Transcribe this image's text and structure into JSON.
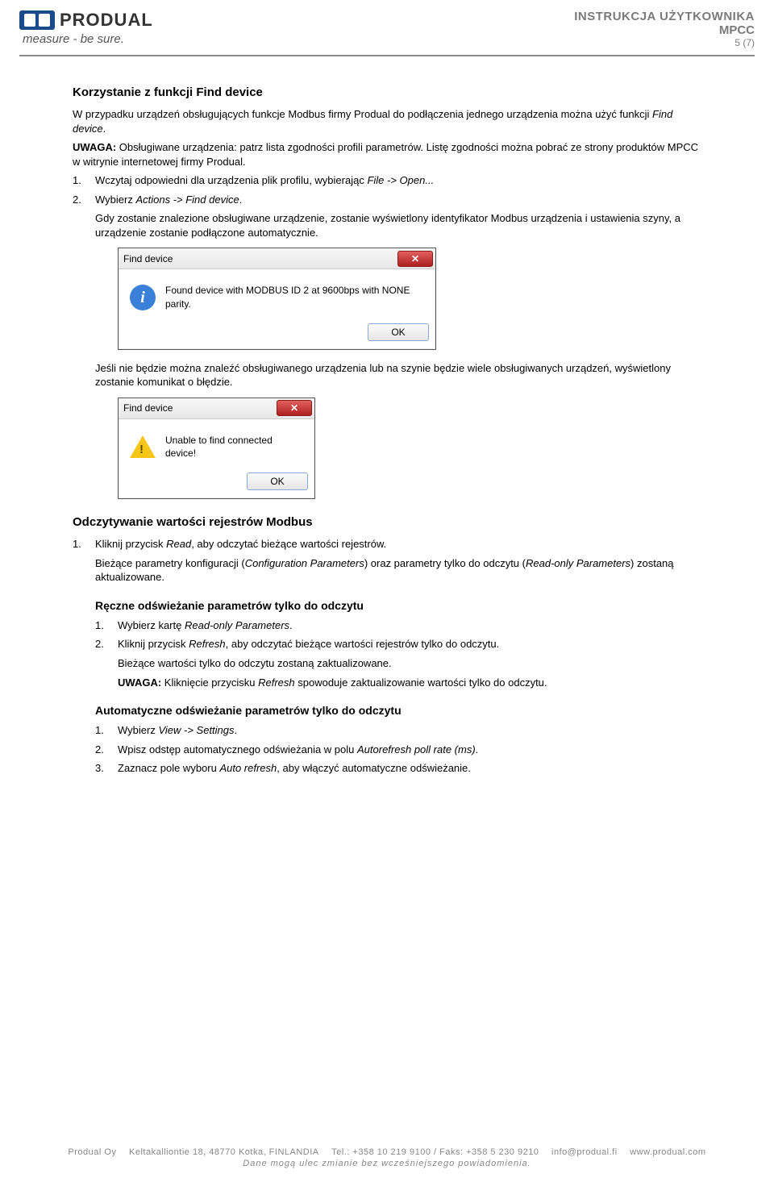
{
  "header": {
    "logo_text": "PRODUAL",
    "tagline": "measure - be sure.",
    "doc_type": "INSTRUKCJA UŻYTKOWNIKA",
    "doc_code": "MPCC",
    "page_num": "5 (7)"
  },
  "sec_find": {
    "title": "Korzystanie z funkcji Find device",
    "p1_a": "W przypadku urządzeń obsługujących funkcje Modbus firmy Produal do podłączenia jednego urządzenia można użyć funkcji ",
    "p1_i": "Find device",
    "p1_b": ".",
    "p2_bold": "UWAGA:",
    "p2": " Obsługiwane urządzenia: patrz lista zgodności profili parametrów. Listę zgodności można pobrać ze strony produktów MPCC w witrynie internetowej firmy Produal.",
    "li1_a": "Wczytaj odpowiedni dla urządzenia plik profilu, wybierając ",
    "li1_i": "File -> Open...",
    "li2_a": "Wybierz ",
    "li2_i": "Actions -> Find device",
    "li2_b": ".",
    "p3": "Gdy zostanie znalezione obsługiwane urządzenie, zostanie wyświetlony identyfikator Modbus urządzenia i ustawienia szyny, a urządzenie zostanie podłączone automatycznie.",
    "p4": "Jeśli nie będzie można znaleźć obsługiwanego urządzenia lub na szynie będzie wiele obsługiwanych urządzeń, wyświetlony zostanie komunikat o błędzie."
  },
  "dlg1": {
    "title": "Find device",
    "msg": "Found device with MODBUS ID 2 at 9600bps with NONE parity.",
    "ok": "OK"
  },
  "dlg2": {
    "title": "Find device",
    "msg": "Unable to find connected device!",
    "ok": "OK"
  },
  "sec_read": {
    "title": "Odczytywanie wartości rejestrów Modbus",
    "li1_a": "Kliknij przycisk ",
    "li1_i": "Read",
    "li1_b": ", aby odczytać bieżące wartości rejestrów.",
    "p_a": "Bieżące parametry konfiguracji (",
    "p_i1": "Configuration Parameters",
    "p_b": ") oraz parametry tylko do odczytu (",
    "p_i2": "Read-only Parameters",
    "p_c": ") zostaną aktualizowane."
  },
  "sec_manual": {
    "title": "Ręczne odświeżanie parametrów tylko do odczytu",
    "li1_a": "Wybierz kartę ",
    "li1_i": "Read-only Parameters",
    "li1_b": ".",
    "li2_a": "Kliknij przycisk ",
    "li2_i": "Refresh",
    "li2_b": ", aby odczytać bieżące wartości rejestrów tylko do odczytu.",
    "p1": "Bieżące wartości tylko do odczytu zostaną zaktualizowane.",
    "p2_bold": "UWAGA:",
    "p2_a": " Kliknięcie przycisku ",
    "p2_i": "Refresh",
    "p2_b": " spowoduje zaktualizowanie wartości tylko do odczytu."
  },
  "sec_auto": {
    "title": "Automatyczne odświeżanie parametrów tylko do odczytu",
    "li1_a": "Wybierz ",
    "li1_i": "View -> Settings",
    "li1_b": ".",
    "li2_a": "Wpisz odstęp automatycznego odświeżania w polu ",
    "li2_i": "Autorefresh poll rate (ms)",
    "li2_b": ".",
    "li3_a": "Zaznacz pole wyboru ",
    "li3_i": "Auto refresh",
    "li3_b": ", aby włączyć automatyczne odświeżanie."
  },
  "footer": {
    "company": "Produal Oy",
    "addr": "Keltakalliontie 18, 48770 Kotka, FINLANDIA",
    "tel": "Tel.: +358 10 219 9100 / Faks: +358 5 230 9210",
    "mail": "info@produal.fi",
    "web": "www.produal.com",
    "disclaimer": "Dane mogą ulec zmianie bez wcześniejszego powiadomienia."
  }
}
